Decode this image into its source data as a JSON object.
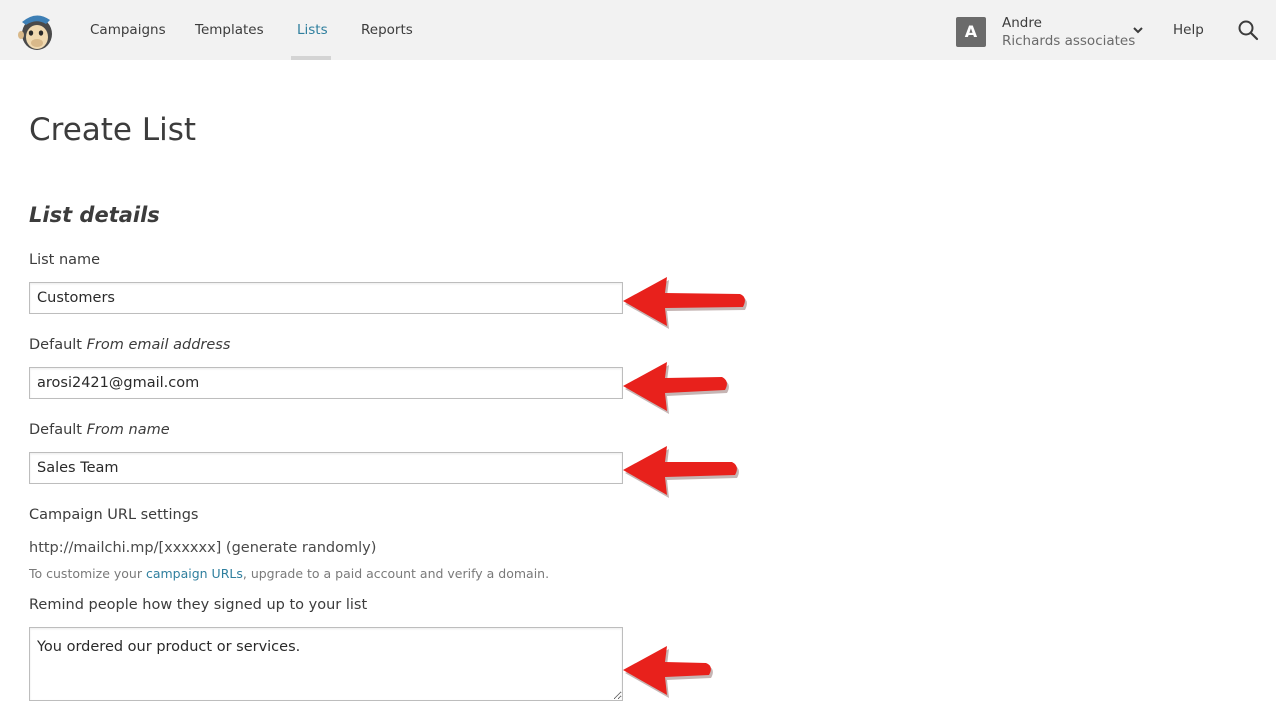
{
  "nav": {
    "items": [
      {
        "label": "Campaigns",
        "active": false
      },
      {
        "label": "Templates",
        "active": false
      },
      {
        "label": "Lists",
        "active": true
      },
      {
        "label": "Reports",
        "active": false
      }
    ],
    "account": {
      "initial": "A",
      "name": "Andre",
      "organization": "Richards associates"
    },
    "help_label": "Help"
  },
  "page": {
    "title": "Create List",
    "section_title": "List details"
  },
  "form": {
    "list_name": {
      "label": "List name",
      "value": "Customers"
    },
    "from_email": {
      "label_prefix": "Default ",
      "label_em": "From email address",
      "value": "arosi2421@gmail.com"
    },
    "from_name": {
      "label_prefix": "Default ",
      "label_em": "From name",
      "value": "Sales Team"
    },
    "url_settings": {
      "label": "Campaign URL settings",
      "value": "http://mailchi.mp/[xxxxxx] (generate randomly)",
      "help_prefix": "To customize your ",
      "help_link": "campaign URLs",
      "help_suffix": ", upgrade to a paid account and verify a domain."
    },
    "reminder": {
      "label": "Remind people how they signed up to your list",
      "value": "You ordered our product or services."
    }
  },
  "colors": {
    "accent": "#2f7f9e",
    "arrow": "#e8211c",
    "topbar": "#f2f2f2"
  }
}
